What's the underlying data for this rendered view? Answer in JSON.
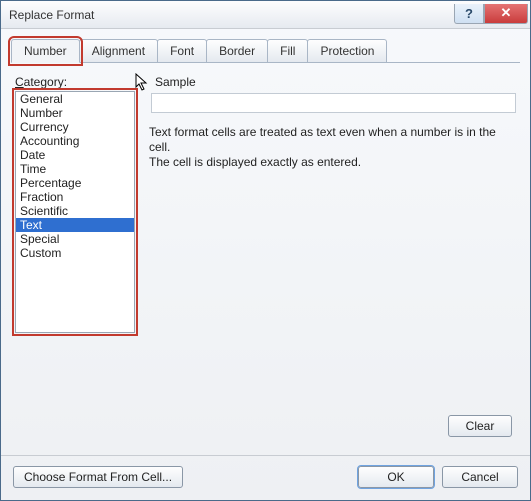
{
  "window": {
    "title": "Replace Format",
    "help_glyph": "?",
    "close_glyph": "✕"
  },
  "tabs": [
    {
      "label": "Number",
      "active": true
    },
    {
      "label": "Alignment",
      "active": false
    },
    {
      "label": "Font",
      "active": false
    },
    {
      "label": "Border",
      "active": false
    },
    {
      "label": "Fill",
      "active": false
    },
    {
      "label": "Protection",
      "active": false
    }
  ],
  "category": {
    "label_pre": "C",
    "label_rest": "ategory:",
    "items": [
      "General",
      "Number",
      "Currency",
      "Accounting",
      "Date",
      "Time",
      "Percentage",
      "Fraction",
      "Scientific",
      "Text",
      "Special",
      "Custom"
    ],
    "selected_index": 9
  },
  "right": {
    "sample_label": "Sample",
    "description_line1": "Text format cells are treated as text even when a number is in the cell.",
    "description_line2": "The cell is displayed exactly as entered."
  },
  "buttons": {
    "clear": "Clear",
    "choose": "Choose Format From Cell...",
    "ok": "OK",
    "cancel": "Cancel"
  }
}
